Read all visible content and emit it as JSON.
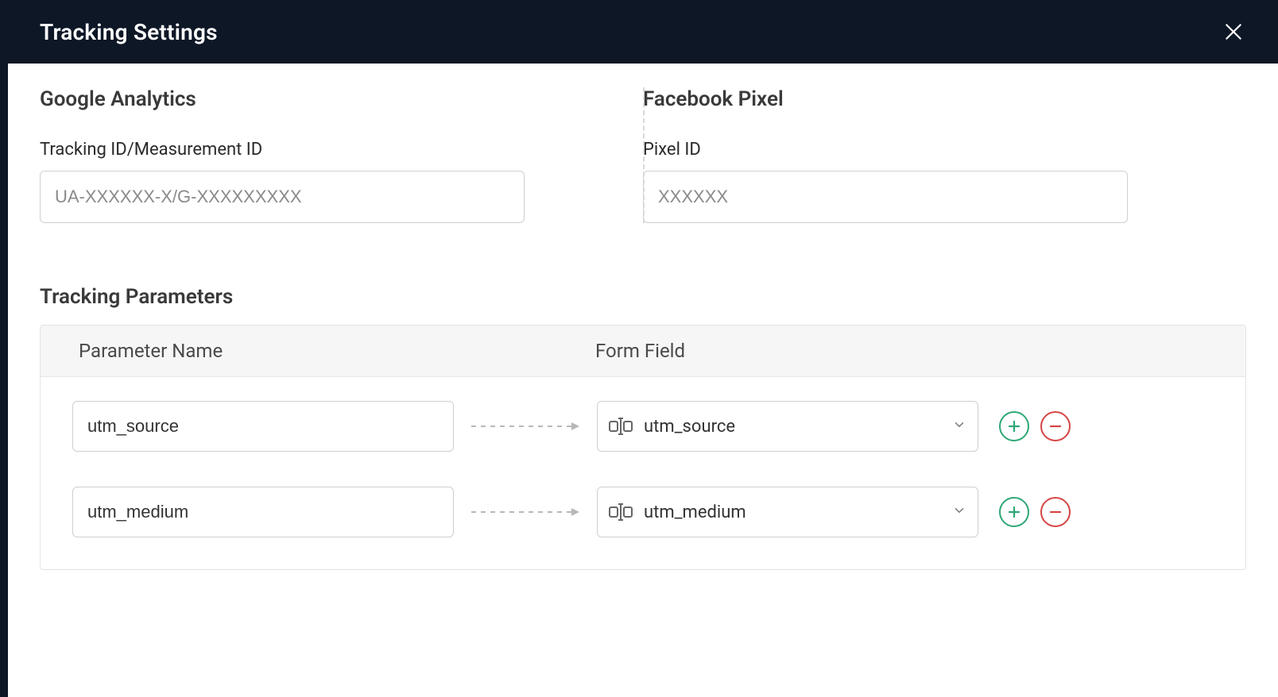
{
  "header": {
    "title": "Tracking Settings"
  },
  "google_analytics": {
    "title": "Google Analytics",
    "label": "Tracking ID/Measurement ID",
    "placeholder": "UA-XXXXXX-X/G-XXXXXXXXX",
    "value": ""
  },
  "facebook_pixel": {
    "title": "Facebook Pixel",
    "label": "Pixel ID",
    "placeholder": "XXXXXX",
    "value": ""
  },
  "tracking_parameters": {
    "title": "Tracking Parameters",
    "columns": {
      "param": "Parameter Name",
      "form": "Form Field"
    },
    "rows": [
      {
        "param_name": "utm_source",
        "form_field": "utm_source"
      },
      {
        "param_name": "utm_medium",
        "form_field": "utm_medium"
      }
    ]
  }
}
